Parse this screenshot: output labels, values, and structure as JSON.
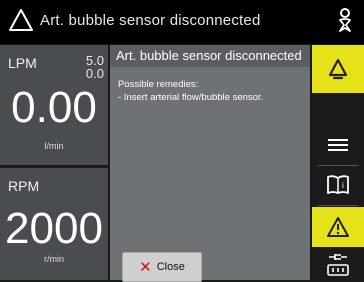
{
  "header": {
    "title": "Art. bubble sensor disconnected",
    "warning_icon": "warning-triangle-icon",
    "user_icon": "user-icon"
  },
  "lpm_panel": {
    "label": "LPM",
    "upper_limit": "5.0",
    "lower_limit": "0.0",
    "value": "0.00",
    "unit": "l/min"
  },
  "rpm_panel": {
    "label": "RPM",
    "value": "2000",
    "unit": "r/min"
  },
  "dialog": {
    "title": "Art. bubble sensor disconnected",
    "remedies_heading": "Possible remedies:",
    "remedy": "- Insert arterial flow/bubble sensor.",
    "close_label": "Close"
  },
  "sidebar": {
    "icons": [
      "alarm-bell-icon",
      "menu-icon",
      "manual-book-icon",
      "warning-icon",
      "power-battery-icon"
    ]
  },
  "colors": {
    "alarm_yellow": "#e6e21a",
    "panel_gray": "#4a4d50",
    "dialog_gray": "#6f7275",
    "close_x_red": "#d1121b"
  }
}
